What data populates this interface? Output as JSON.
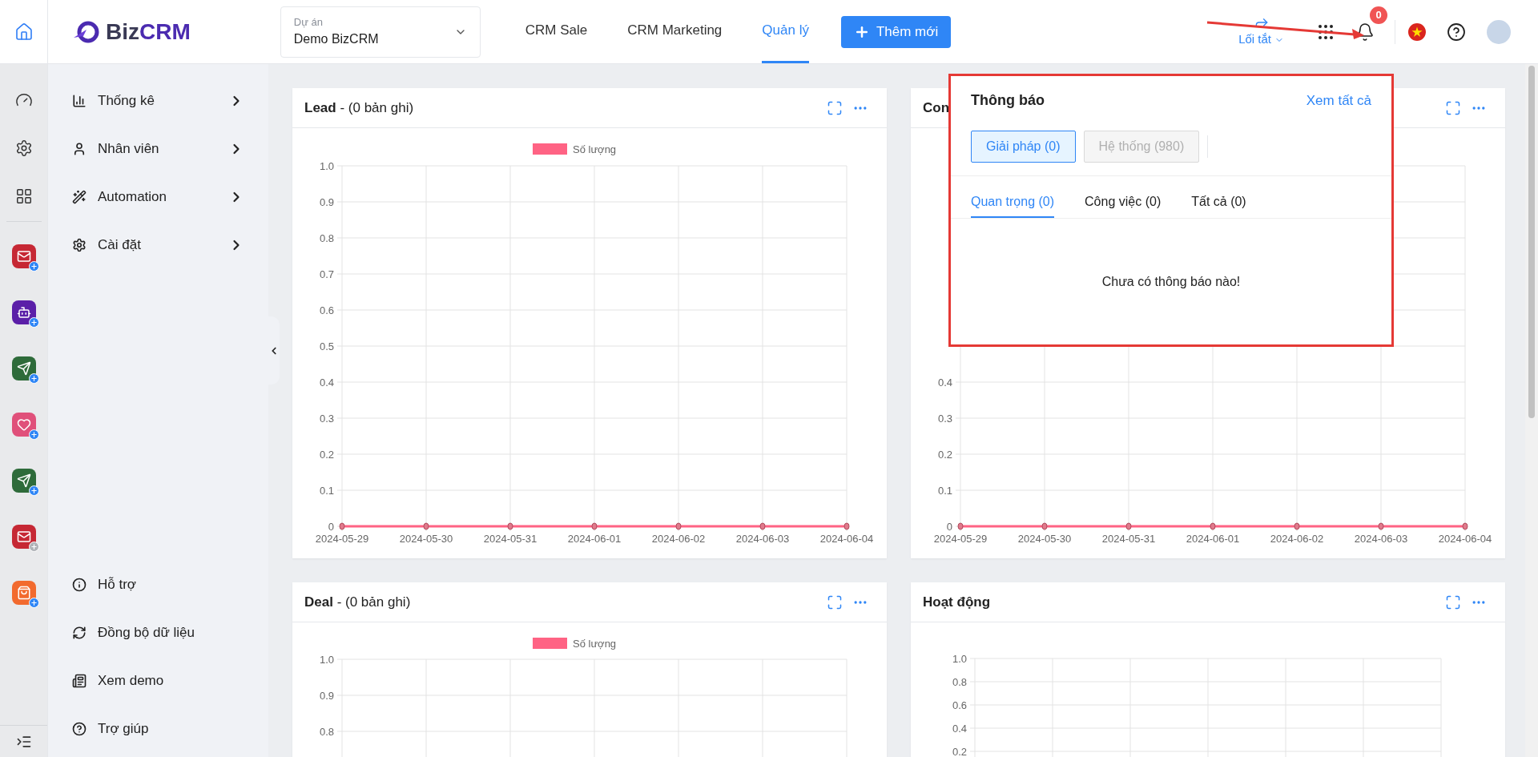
{
  "topbar": {
    "logo": {
      "first": "Biz",
      "second": "CRM"
    },
    "project": {
      "label": "Dự án",
      "value": "Demo BizCRM"
    },
    "nav": [
      {
        "label": "CRM Sale",
        "selected": false
      },
      {
        "label": "CRM Marketing",
        "selected": false
      },
      {
        "label": "Quản lý",
        "selected": true
      }
    ],
    "add_button": "Thêm mới",
    "shortcut": "Lối tắt",
    "notification_count": "0"
  },
  "rail": {
    "apps": [
      {
        "kind": "mail",
        "color": "#c62834",
        "active": true
      },
      {
        "kind": "bot",
        "color": "#5b1fa8",
        "active": true
      },
      {
        "kind": "send",
        "color": "#2e6b3a",
        "active": true
      },
      {
        "kind": "heart",
        "color": "#e0507a",
        "active": true
      },
      {
        "kind": "send",
        "color": "#2e6b3a",
        "active": true
      },
      {
        "kind": "mail",
        "color": "#c62834",
        "active": false
      },
      {
        "kind": "bag",
        "color": "#f26a2e",
        "active": true
      }
    ]
  },
  "sidebar": {
    "menu": [
      {
        "label": "Thống kê",
        "kind": "chart"
      },
      {
        "label": "Nhân viên",
        "kind": "user"
      },
      {
        "label": "Automation",
        "kind": "wand"
      },
      {
        "label": "Cài đặt",
        "kind": "gear"
      }
    ],
    "bottom": [
      {
        "label": "Hỗ trợ",
        "kind": "info"
      },
      {
        "label": "Đồng bộ dữ liệu",
        "kind": "sync"
      },
      {
        "label": "Xem demo",
        "kind": "demo"
      },
      {
        "label": "Trợ giúp",
        "kind": "help"
      }
    ]
  },
  "cards": [
    {
      "title": "**Lead** - (0 bản ghi)",
      "kind": "full",
      "chart_data": {
        "type": "line",
        "grid": true,
        "categories": [
          "2024-05-29",
          "2024-05-30",
          "2024-05-31",
          "2024-06-01",
          "2024-06-02",
          "2024-06-03",
          "2024-06-04"
        ],
        "series": [
          {
            "name": "Số lượng",
            "color": "#ff6384",
            "marker": true,
            "values": [
              0,
              0,
              0,
              0,
              0,
              0,
              0
            ]
          }
        ],
        "ylim": [
          0,
          1
        ],
        "yticks": [
          0,
          0.1,
          0.2,
          0.3,
          0.4,
          0.5,
          0.6,
          0.7,
          0.8,
          0.9,
          {
            "value": 1,
            "label": "1.0"
          }
        ]
      }
    },
    {
      "title": "**Con**",
      "kind": "full",
      "chart_data": {
        "type": "line",
        "grid": true,
        "categories": [
          "2024-05-29",
          "2024-05-30",
          "2024-05-31",
          "2024-06-01",
          "2024-06-02",
          "2024-06-03",
          "2024-06-04"
        ],
        "series": [
          {
            "color": "#ff6384",
            "marker": true,
            "values": [
              0,
              0,
              0,
              0,
              0,
              0,
              0
            ]
          }
        ],
        "ylim": [
          0,
          1
        ],
        "yticks": [
          0,
          0.1,
          0.2,
          0.3,
          0.4
        ]
      }
    },
    {
      "title": "**Deal** - (0 bản ghi)",
      "kind": "partial",
      "legend": {
        "label": "Số lượng",
        "color": "#ff6384"
      },
      "y_tick_labels": [
        "1.0",
        "0.9",
        "0.8"
      ]
    },
    {
      "title": "**Hoạt động**",
      "kind": "partial",
      "y_tick_labels": [
        "1.0",
        "0.8",
        "0.6",
        "0.4",
        "0.2"
      ]
    }
  ],
  "notifications": {
    "title": "Thông báo",
    "view_all": "Xem tất cả",
    "groups": [
      {
        "label": "Giải pháp (0)",
        "selected": true
      },
      {
        "label": "Hệ thống (980)",
        "selected": false
      }
    ],
    "tabs": [
      {
        "label": "Quan trọng (0)",
        "selected": true
      },
      {
        "label": "Công việc (0)",
        "selected": false
      },
      {
        "label": "Tất cả (0)",
        "selected": false
      }
    ],
    "empty": "Chưa có thông báo nào!"
  }
}
